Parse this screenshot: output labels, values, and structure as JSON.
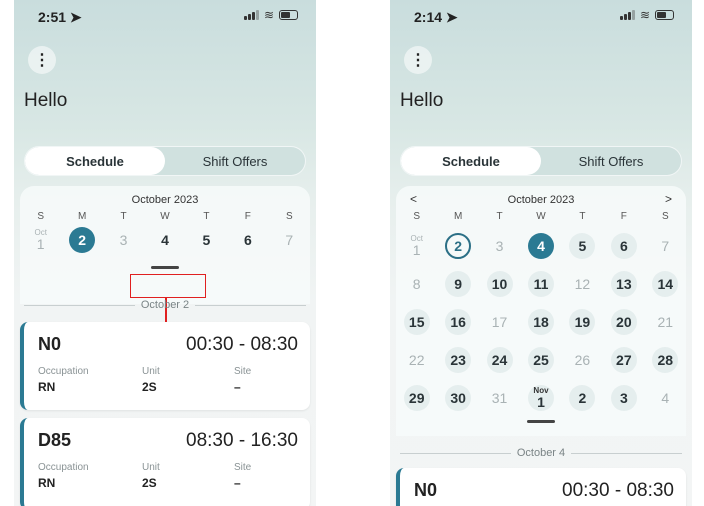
{
  "left_screen": {
    "status_time": "2:51",
    "menu_glyph": "⋮",
    "greeting": "Hello",
    "tabs": [
      {
        "label": "Schedule",
        "active": true
      },
      {
        "label": "Shift Offers",
        "active": false
      }
    ],
    "calendar": {
      "month": "October 2023",
      "weekdays": [
        "S",
        "M",
        "T",
        "W",
        "T",
        "F",
        "S"
      ],
      "week": [
        {
          "top": "Oct",
          "num": "1",
          "state": "muted"
        },
        {
          "num": "2",
          "state": "selected"
        },
        {
          "num": "3",
          "state": "muted"
        },
        {
          "num": "4",
          "state": "normal"
        },
        {
          "num": "5",
          "state": "normal"
        },
        {
          "num": "6",
          "state": "normal"
        },
        {
          "num": "7",
          "state": "muted"
        }
      ]
    },
    "date_divider": "October 2",
    "shifts": [
      {
        "code": "N0",
        "time": "00:30 - 08:30",
        "fields": [
          {
            "label": "Occupation",
            "value": "RN"
          },
          {
            "label": "Unit",
            "value": "2S"
          },
          {
            "label": "Site",
            "value": "–"
          }
        ]
      },
      {
        "code": "D85",
        "time": "08:30 - 16:30",
        "fields": [
          {
            "label": "Occupation",
            "value": "RN"
          },
          {
            "label": "Unit",
            "value": "2S"
          },
          {
            "label": "Site",
            "value": "–"
          }
        ]
      }
    ]
  },
  "right_screen": {
    "status_time": "2:14",
    "menu_glyph": "⋮",
    "greeting": "Hello",
    "tabs": [
      {
        "label": "Schedule",
        "active": true
      },
      {
        "label": "Shift Offers",
        "active": false
      }
    ],
    "calendar": {
      "month": "October 2023",
      "prev_glyph": "<",
      "next_glyph": ">",
      "weekdays": [
        "S",
        "M",
        "T",
        "W",
        "T",
        "F",
        "S"
      ],
      "weeks": [
        [
          {
            "top": "Oct",
            "num": "1",
            "state": "muted"
          },
          {
            "num": "2",
            "state": "today"
          },
          {
            "num": "3",
            "state": "muted"
          },
          {
            "num": "4",
            "state": "selected"
          },
          {
            "num": "5",
            "state": "shift"
          },
          {
            "num": "6",
            "state": "shift"
          },
          {
            "num": "7",
            "state": "muted"
          }
        ],
        [
          {
            "num": "8",
            "state": "muted"
          },
          {
            "num": "9",
            "state": "shift"
          },
          {
            "num": "10",
            "state": "shift"
          },
          {
            "num": "11",
            "state": "shift"
          },
          {
            "num": "12",
            "state": "muted"
          },
          {
            "num": "13",
            "state": "shift"
          },
          {
            "num": "14",
            "state": "shift"
          }
        ],
        [
          {
            "num": "15",
            "state": "shift"
          },
          {
            "num": "16",
            "state": "shift"
          },
          {
            "num": "17",
            "state": "muted"
          },
          {
            "num": "18",
            "state": "shift"
          },
          {
            "num": "19",
            "state": "shift"
          },
          {
            "num": "20",
            "state": "shift"
          },
          {
            "num": "21",
            "state": "muted"
          }
        ],
        [
          {
            "num": "22",
            "state": "muted"
          },
          {
            "num": "23",
            "state": "shift"
          },
          {
            "num": "24",
            "state": "shift"
          },
          {
            "num": "25",
            "state": "shift"
          },
          {
            "num": "26",
            "state": "muted"
          },
          {
            "num": "27",
            "state": "shift"
          },
          {
            "num": "28",
            "state": "shift"
          }
        ],
        [
          {
            "num": "29",
            "state": "shift"
          },
          {
            "num": "30",
            "state": "shift"
          },
          {
            "num": "31",
            "state": "muted"
          },
          {
            "top": "Nov",
            "num": "1",
            "state": "shift"
          },
          {
            "num": "2",
            "state": "shift"
          },
          {
            "num": "3",
            "state": "shift"
          },
          {
            "num": "4",
            "state": "muted"
          }
        ]
      ]
    },
    "date_divider": "October 4",
    "shifts": [
      {
        "code": "N0",
        "time": "00:30 - 08:30"
      }
    ]
  },
  "colors": {
    "accent": "#2b7a93",
    "highlight": "#e02020"
  }
}
